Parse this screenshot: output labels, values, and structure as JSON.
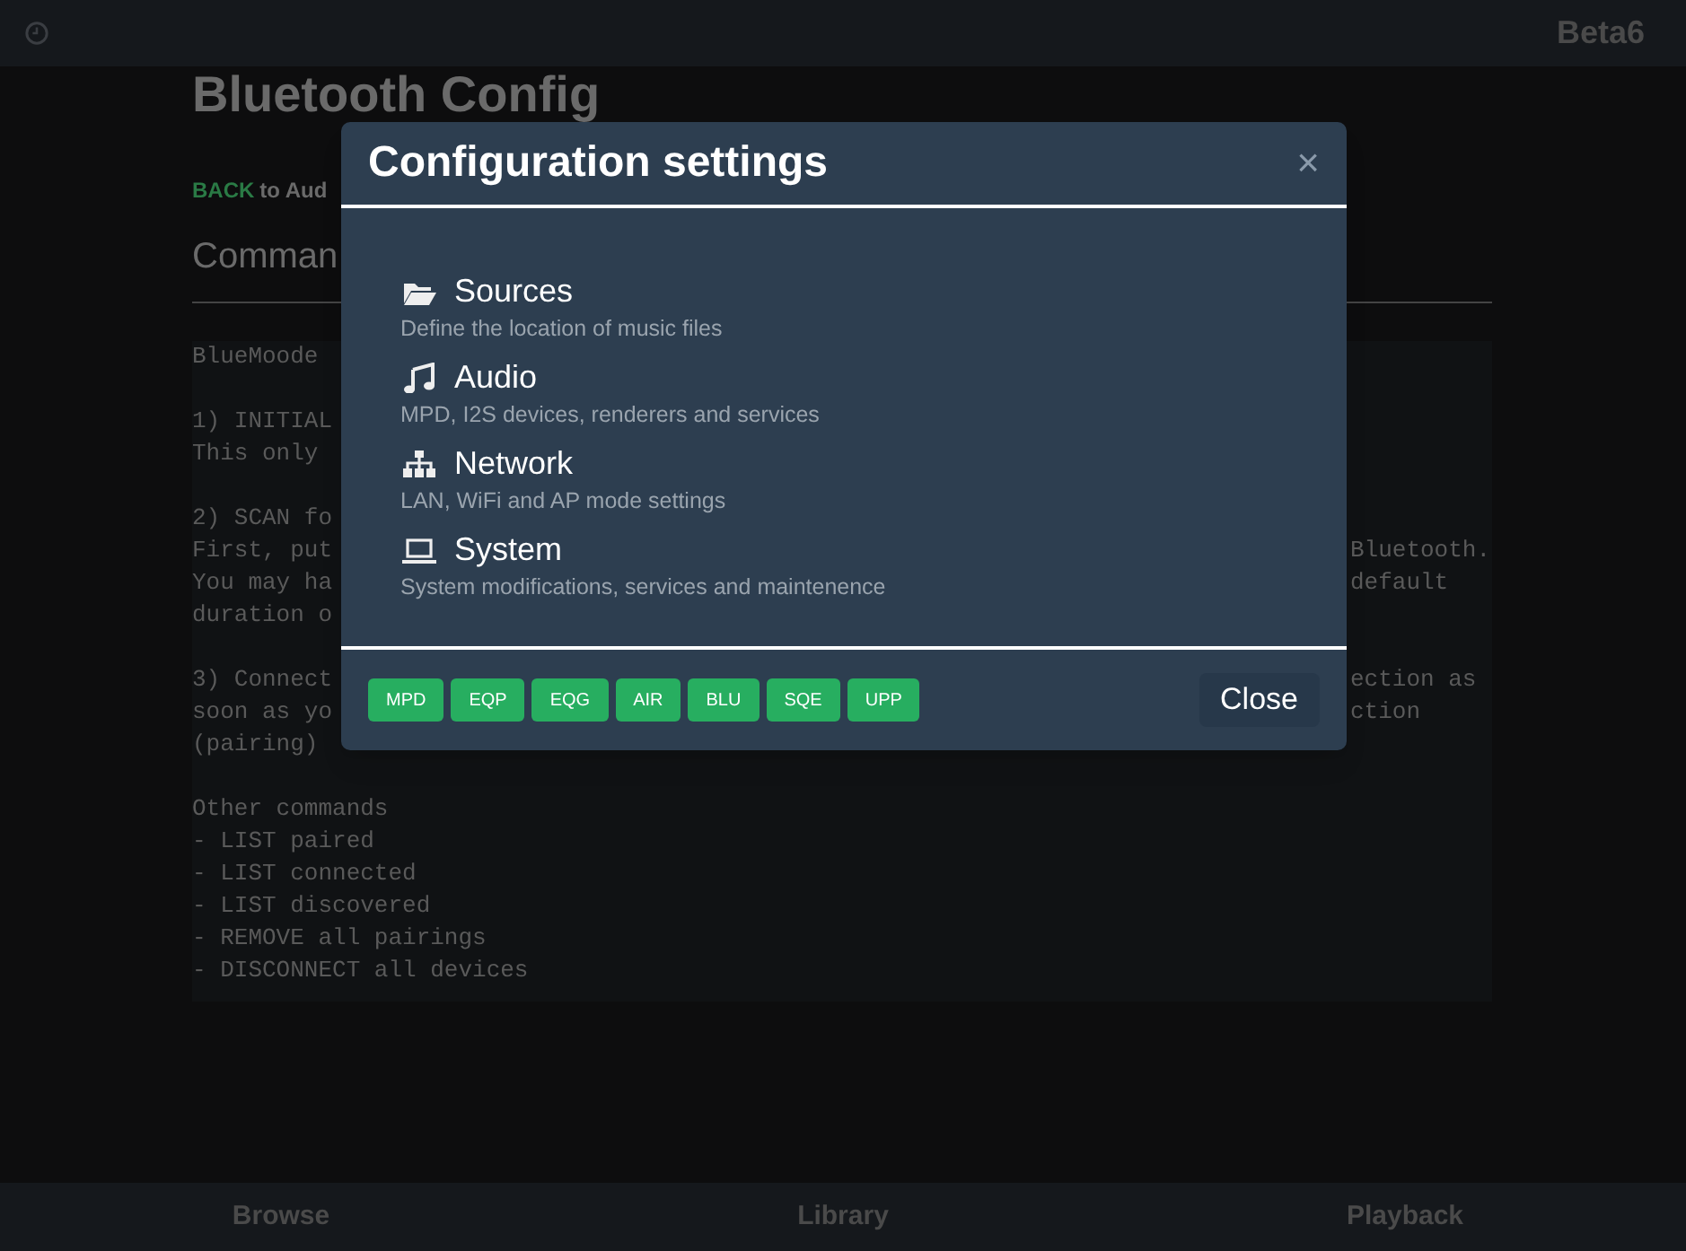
{
  "top_bar": {
    "version": "Beta6"
  },
  "page": {
    "title": "Bluetooth Config",
    "back_link": "BACK",
    "back_text": "to Aud",
    "heading": "Comman",
    "console_lines": [
      {
        "kind": "text",
        "left": "BlueMoode"
      },
      {
        "kind": "blank"
      },
      {
        "kind": "text",
        "left": "1) INITIAL"
      },
      {
        "kind": "text",
        "left": "This only"
      },
      {
        "kind": "blank"
      },
      {
        "kind": "text",
        "left": "2) SCAN fo"
      },
      {
        "kind": "text",
        "left": "First, put",
        "right": "Bluetooth."
      },
      {
        "kind": "text",
        "left": "You may ha",
        "right": "default"
      },
      {
        "kind": "text",
        "left": "duration o"
      },
      {
        "kind": "blank"
      },
      {
        "kind": "text",
        "left": "3) Connect",
        "right": "ection as"
      },
      {
        "kind": "text",
        "left": "soon as yo",
        "right": "ction"
      },
      {
        "kind": "text",
        "left": "(pairing)"
      },
      {
        "kind": "blank"
      },
      {
        "kind": "text",
        "left": "Other commands"
      },
      {
        "kind": "text",
        "left": "- LIST paired"
      },
      {
        "kind": "text",
        "left": "- LIST connected"
      },
      {
        "kind": "text",
        "left": "- LIST discovered"
      },
      {
        "kind": "text",
        "left": "- REMOVE all pairings"
      },
      {
        "kind": "text",
        "left": "- DISCONNECT all devices"
      }
    ]
  },
  "modal": {
    "title": "Configuration settings",
    "close_glyph": "×",
    "items": [
      {
        "kind": "folder",
        "title": "Sources",
        "description": "Define the location of music files"
      },
      {
        "kind": "music",
        "title": "Audio",
        "description": "MPD, I2S devices, renderers and services"
      },
      {
        "kind": "network",
        "title": "Network",
        "description": "LAN, WiFi and AP mode settings"
      },
      {
        "kind": "laptop",
        "title": "System",
        "description": "System modifications, services and maintenence"
      }
    ],
    "buttons": [
      "MPD",
      "EQP",
      "EQG",
      "AIR",
      "BLU",
      "SQE",
      "UPP"
    ],
    "close_button": "Close"
  },
  "bottom_nav": [
    "Browse",
    "Library",
    "Playback"
  ]
}
